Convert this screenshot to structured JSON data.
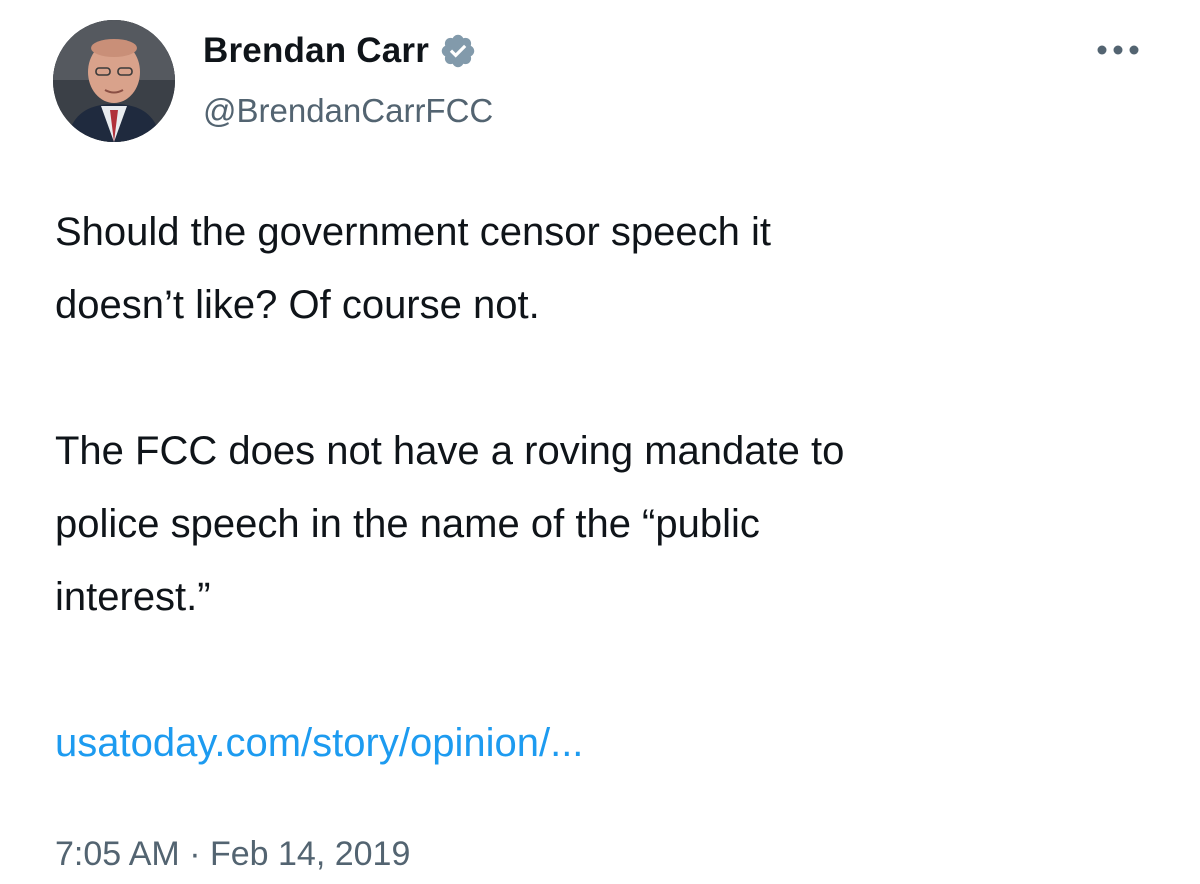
{
  "author": {
    "display_name": "Brendan Carr",
    "handle": "@BrendanCarrFCC",
    "verified_icon": "verified-badge-icon",
    "verified_color": "#829aab"
  },
  "menu": {
    "icon": "more-options-icon"
  },
  "tweet": {
    "paragraph_1_line_1": "Should the government censor speech it",
    "paragraph_1_line_2": "doesn’t like?  Of course not.",
    "paragraph_2_line_1": "The FCC does not have a roving mandate to",
    "paragraph_2_line_2": "police speech in the name of the “public",
    "paragraph_2_line_3": "interest.”",
    "link_text": "usatoday.com/story/opinion/...",
    "link_color": "#1d9bf0"
  },
  "meta": {
    "time": "7:05 AM",
    "separator": "·",
    "date": "Feb 14, 2019"
  }
}
